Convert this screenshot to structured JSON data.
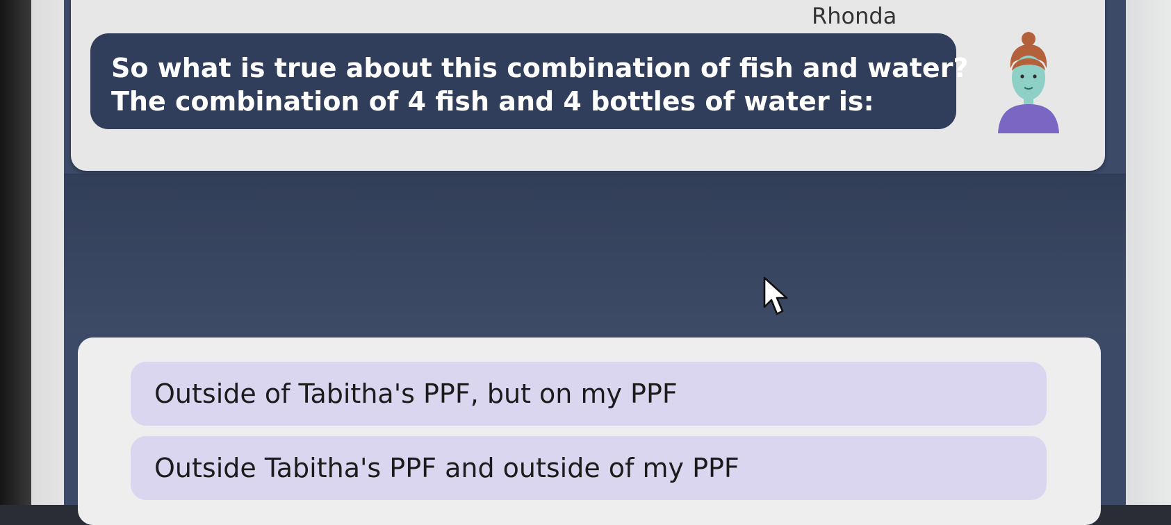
{
  "speaker": {
    "name": "Rhonda"
  },
  "prompt": {
    "line1": "So what is true about this combination of fish and water?",
    "line2": "The combination of 4 fish and 4 bottles of water is:"
  },
  "answers": [
    {
      "label": "Outside of Tabitha's PPF, but on my PPF"
    },
    {
      "label": "Outside Tabitha's PPF and outside of my PPF"
    }
  ],
  "colors": {
    "stage": "#3c4a67",
    "bubble": "#303e5c",
    "option": "#dbd6f0",
    "card": "#e6e7e6"
  },
  "icons": {
    "avatar": "avatar-icon",
    "cursor": "mouse-pointer-icon"
  }
}
